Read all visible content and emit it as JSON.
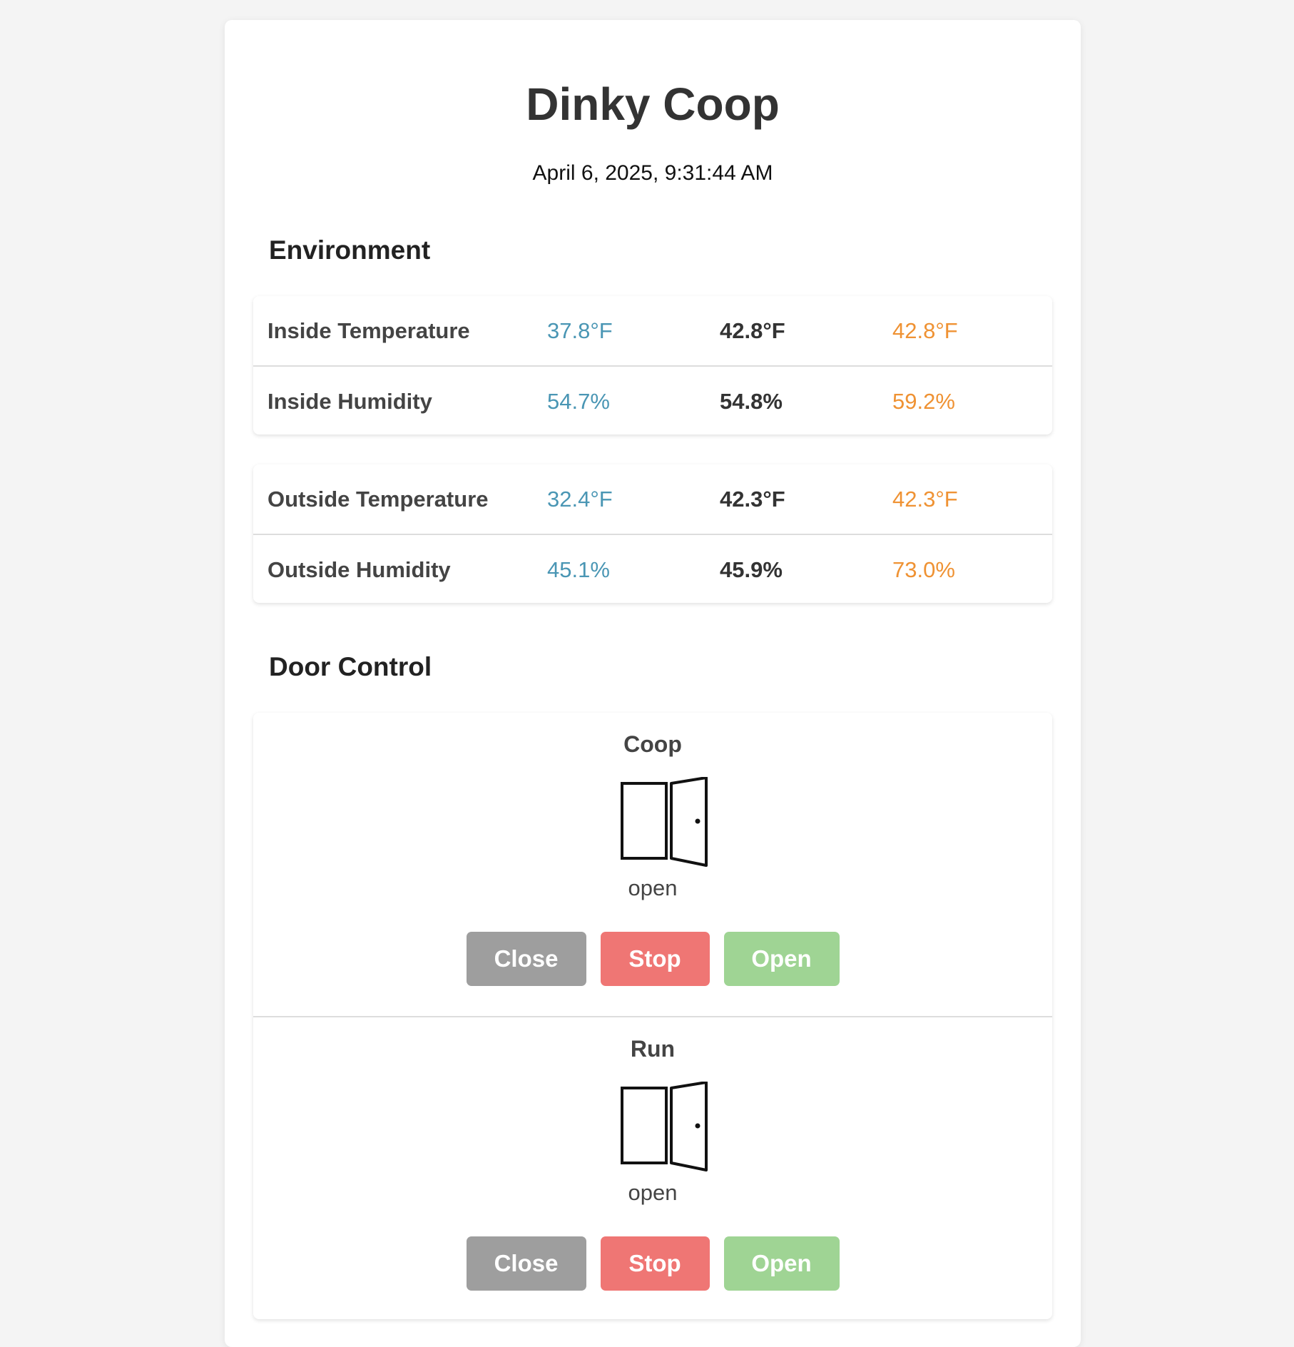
{
  "header": {
    "title": "Dinky Coop",
    "timestamp": "April 6, 2025, 9:31:44 AM"
  },
  "environment": {
    "heading": "Environment",
    "groups": [
      {
        "rows": [
          {
            "label": "Inside Temperature",
            "low": "37.8°F",
            "current": "42.8°F",
            "high": "42.8°F"
          },
          {
            "label": "Inside Humidity",
            "low": "54.7%",
            "current": "54.8%",
            "high": "59.2%"
          }
        ]
      },
      {
        "rows": [
          {
            "label": "Outside Temperature",
            "low": "32.4°F",
            "current": "42.3°F",
            "high": "42.3°F"
          },
          {
            "label": "Outside Humidity",
            "low": "45.1%",
            "current": "45.9%",
            "high": "73.0%"
          }
        ]
      }
    ],
    "colors": {
      "low": "#4a96b4",
      "current": "#333333",
      "high": "#ef9233"
    }
  },
  "door_control": {
    "heading": "Door Control",
    "doors": [
      {
        "name": "Coop",
        "icon": "door-open-icon",
        "status": "open",
        "buttons": {
          "close": "Close",
          "stop": "Stop",
          "open": "Open"
        }
      },
      {
        "name": "Run",
        "icon": "door-open-icon",
        "status": "open",
        "buttons": {
          "close": "Close",
          "stop": "Stop",
          "open": "Open"
        }
      }
    ],
    "colors": {
      "close": "#9e9e9e",
      "stop": "#ef7674",
      "open": "#9fd494"
    }
  }
}
